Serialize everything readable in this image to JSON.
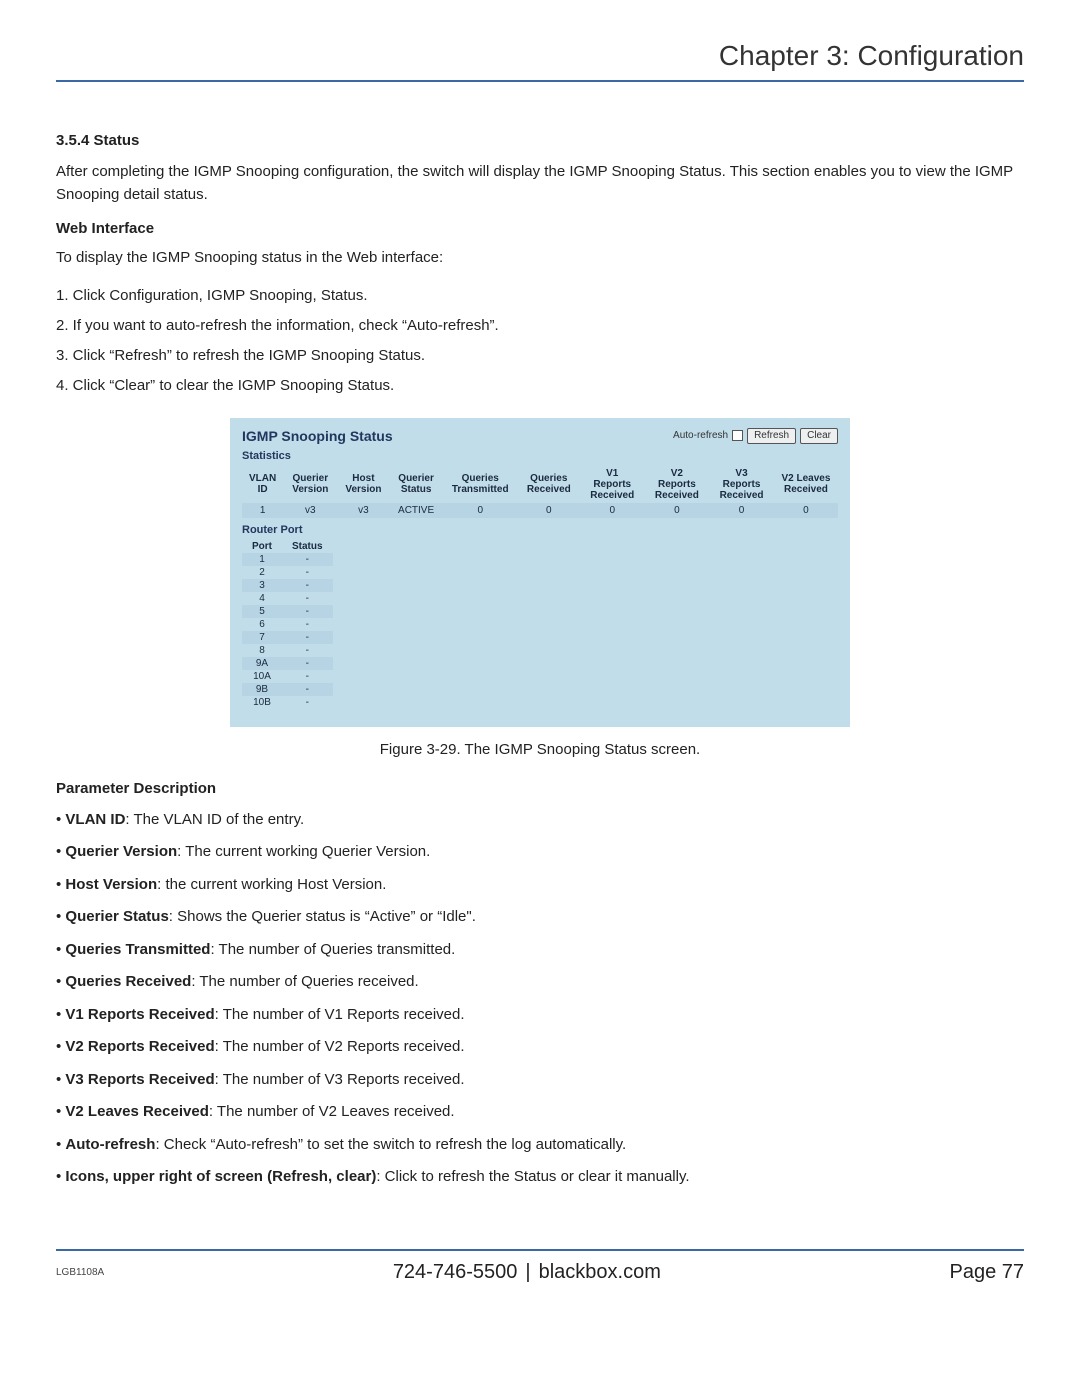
{
  "chapter_title": "Chapter 3: Configuration",
  "section": {
    "number_title": "3.5.4 Status",
    "intro": "After completing the IGMP Snooping configuration, the switch will display the IGMP Snooping Status. This section enables you to view the IGMP Snooping detail status.",
    "web_interface_heading": "Web Interface",
    "web_interface_intro": "To display the IGMP Snooping status in the Web interface:",
    "steps": [
      "1. Click Configuration, IGMP Snooping, Status.",
      "2. If you want to auto-refresh the information, check “Auto-refresh”.",
      "3. Click “Refresh” to refresh the IGMP Snooping Status.",
      "4. Click “Clear” to clear the IGMP Snooping Status."
    ]
  },
  "panel": {
    "title": "IGMP Snooping Status",
    "auto_refresh_label": "Auto-refresh",
    "refresh_btn": "Refresh",
    "clear_btn": "Clear",
    "statistics_label": "Statistics",
    "stat_headers": [
      "VLAN ID",
      "Querier Version",
      "Host Version",
      "Querier Status",
      "Queries Transmitted",
      "Queries Received",
      "V1 Reports Received",
      "V2 Reports Received",
      "V3 Reports Received",
      "V2 Leaves Received"
    ],
    "stat_row": [
      "1",
      "v3",
      "v3",
      "ACTIVE",
      "0",
      "0",
      "0",
      "0",
      "0",
      "0"
    ],
    "router_port_label": "Router Port",
    "rport_headers": [
      "Port",
      "Status"
    ],
    "rport_rows": [
      [
        "1",
        "-"
      ],
      [
        "2",
        "-"
      ],
      [
        "3",
        "-"
      ],
      [
        "4",
        "-"
      ],
      [
        "5",
        "-"
      ],
      [
        "6",
        "-"
      ],
      [
        "7",
        "-"
      ],
      [
        "8",
        "-"
      ],
      [
        "9A",
        "-"
      ],
      [
        "10A",
        "-"
      ],
      [
        "9B",
        "-"
      ],
      [
        "10B",
        "-"
      ]
    ]
  },
  "caption": "Figure 3-29. The IGMP Snooping Status screen.",
  "params": {
    "heading": "Parameter Description",
    "items": [
      {
        "term": "VLAN ID",
        "desc": ": The VLAN ID of the entry."
      },
      {
        "term": "Querier Version",
        "desc": ": The current working Querier Version."
      },
      {
        "term": "Host Version",
        "desc": ": the current working Host Version."
      },
      {
        "term": "Querier Status",
        "desc": ": Shows the Querier status is “Active” or “Idle\"."
      },
      {
        "term": "Queries Transmitted",
        "desc": ": The number of Queries transmitted."
      },
      {
        "term": "Queries Received",
        "desc": ": The number of Queries received."
      },
      {
        "term": "V1 Reports Received",
        "desc": ": The number of V1 Reports received."
      },
      {
        "term": "V2 Reports Received",
        "desc": ": The number of V2 Reports received."
      },
      {
        "term": "V3 Reports Received",
        "desc": ": The number of V3 Reports received."
      },
      {
        "term": "V2 Leaves Received",
        "desc": ": The number of V2 Leaves received."
      },
      {
        "term": "Auto-refresh",
        "desc": ": Check “Auto-refresh” to set the switch to refresh the log automatically."
      },
      {
        "term": "Icons, upper right of screen (Refresh, clear)",
        "desc": ": Click to refresh the Status or clear it manually."
      }
    ]
  },
  "footer": {
    "model": "LGB1108A",
    "phone": "724-746-5500",
    "site": "blackbox.com",
    "page": "Page 77"
  }
}
